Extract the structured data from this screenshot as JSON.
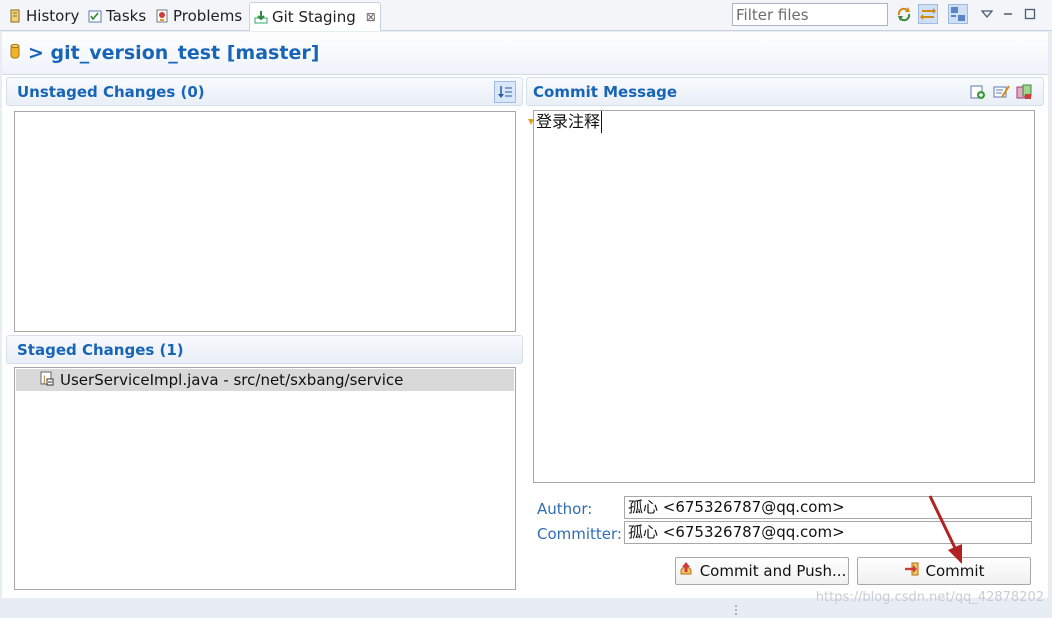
{
  "tabs": [
    {
      "label": "History",
      "icon": "history-icon"
    },
    {
      "label": "Tasks",
      "icon": "tasks-icon"
    },
    {
      "label": "Problems",
      "icon": "problems-icon"
    },
    {
      "label": "Git Staging",
      "icon": "git-staging-icon",
      "active": true,
      "close": "⊠"
    }
  ],
  "toolbar": {
    "filter_placeholder": "Filter files",
    "icons": [
      "refresh-icon",
      "link-with-selection-icon",
      "presentation-icon",
      "view-menu-icon",
      "minimize-icon",
      "maximize-icon"
    ]
  },
  "header": {
    "repo_icon": "repository-icon",
    "title": "> git_version_test [master]"
  },
  "unstaged": {
    "title": "Unstaged Changes (0)",
    "sort_icon": "sort-icon"
  },
  "staged": {
    "title": "Staged Changes (1)",
    "files": [
      {
        "label": "UserServiceImpl.java - src/net/sxbang/service",
        "icon": "java-file-icon"
      }
    ]
  },
  "commit_message": {
    "title": "Commit Message",
    "text": "登录注释",
    "icons": [
      "add-signed-off-icon",
      "amend-icon",
      "compare-icon"
    ]
  },
  "author": {
    "label": "Author:",
    "value": "孤心 <675326787@qq.com>"
  },
  "committer": {
    "label": "Committer:",
    "value": "孤心 <675326787@qq.com>"
  },
  "buttons": {
    "commit_and_push": "Commit and Push...",
    "commit": "Commit"
  },
  "watermark": "https://blog.csdn.net/qq_42878202",
  "colors": {
    "accent": "#1865b7",
    "annotation_arrow": "#b22222"
  }
}
